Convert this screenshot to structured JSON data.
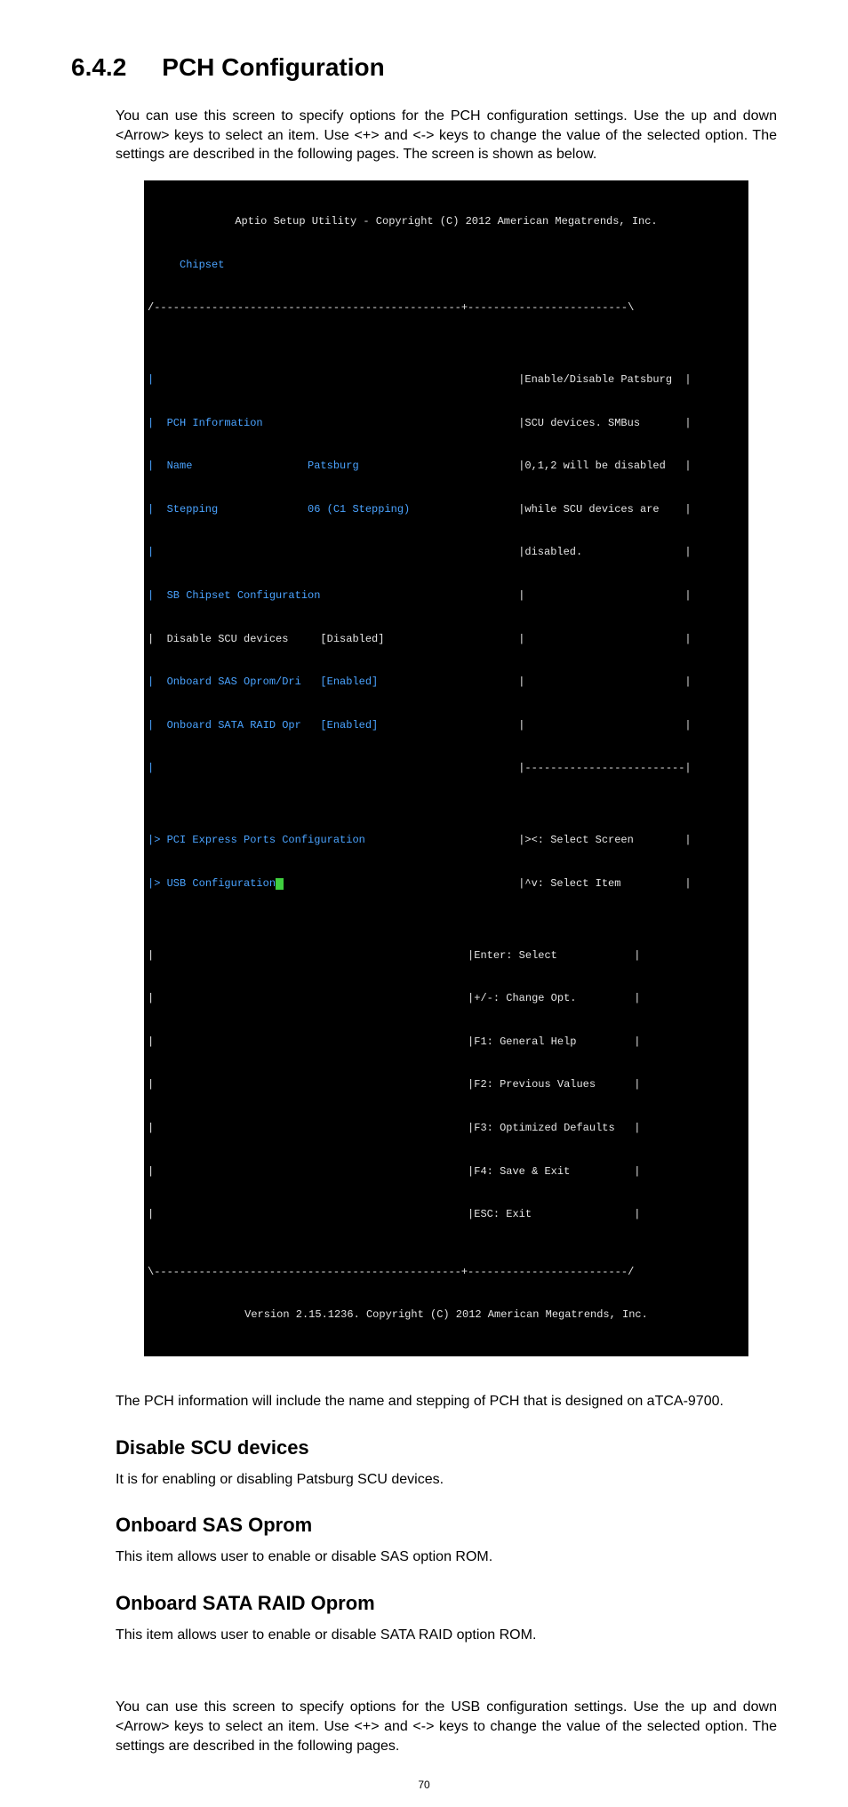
{
  "section": {
    "number": "6.4.2",
    "title": "PCH Configuration"
  },
  "intro": "You can use this screen to specify options for the PCH configuration settings. Use the up and down <Arrow> keys to select an item. Use <+> and <-> keys to change the value of the selected option. The settings are described in the following pages. The screen is shown as below.",
  "bios": {
    "header1": "Aptio Setup Utility - Copyright (C) 2012 American Megatrends, Inc.",
    "header2": "     Chipset",
    "topBorder": "/------------------------------------------------+-------------------------\\",
    "sepLine": "|                                                 |-------------------------|",
    "botBorder": "\\------------------------------------------------+-------------------------/",
    "footer": "Version 2.15.1236. Copyright (C) 2012 American Megatrends, Inc.",
    "leftRows": [
      "|                                                ",
      "|  PCH Information                               ",
      "|  Name                  Patsburg                ",
      "|  Stepping              06 (C1 Stepping)        ",
      "|                                                ",
      "|  SB Chipset Configuration                      ",
      "|  Disable SCU devices     [Disabled]            ",
      "|  Onboard SAS Oprom/Dri   [Enabled]             ",
      "|  Onboard SATA RAID Opr   [Enabled]             ",
      "|                                                "
    ],
    "rightHelp": [
      " |Enable/Disable Patsburg  |",
      " |SCU devices. SMBus       |",
      " |0,1,2 will be disabled   |",
      " |while SCU devices are    |",
      " |disabled.                |",
      " |                         |",
      " |                         |",
      " |                         |",
      " |                         |",
      " |-------------------------|"
    ],
    "menuRows": [
      {
        "prefix": "|> ",
        "label": "PCI Express Ports Configuration",
        "cursor": false,
        "pad": "              "
      },
      {
        "prefix": "|> ",
        "label": "USB Configuration",
        "cursor": true,
        "pad": "                           "
      }
    ],
    "menuRight": [
      " |><: Select Screen        |",
      " |^v: Select Item          |"
    ],
    "navRows": [
      "|                                                 |Enter: Select            |",
      "|                                                 |+/-: Change Opt.         |",
      "|                                                 |F1: General Help         |",
      "|                                                 |F2: Previous Values      |",
      "|                                                 |F3: Optimized Defaults   |",
      "|                                                 |F4: Save & Exit          |",
      "|                                                 |ESC: Exit                |"
    ]
  },
  "afterBios": "The PCH information will include the name and stepping of PCH that is designed on aTCA-9700.",
  "sub1": {
    "title": "Disable SCU devices",
    "body": "It is for enabling or disabling Patsburg SCU devices."
  },
  "sub2": {
    "title": "Onboard SAS Oprom",
    "body": "This item allows user to enable or disable SAS option ROM."
  },
  "sub3": {
    "title": "Onboard SATA RAID Oprom",
    "body": "This item allows user to enable or disable SATA RAID option ROM."
  },
  "outro": "You can use this screen to specify options for the USB configuration settings. Use the up and down <Arrow> keys to select an item. Use <+> and <-> keys to change the value of the selected option. The settings are described in the following pages.",
  "pageNumber": "70"
}
